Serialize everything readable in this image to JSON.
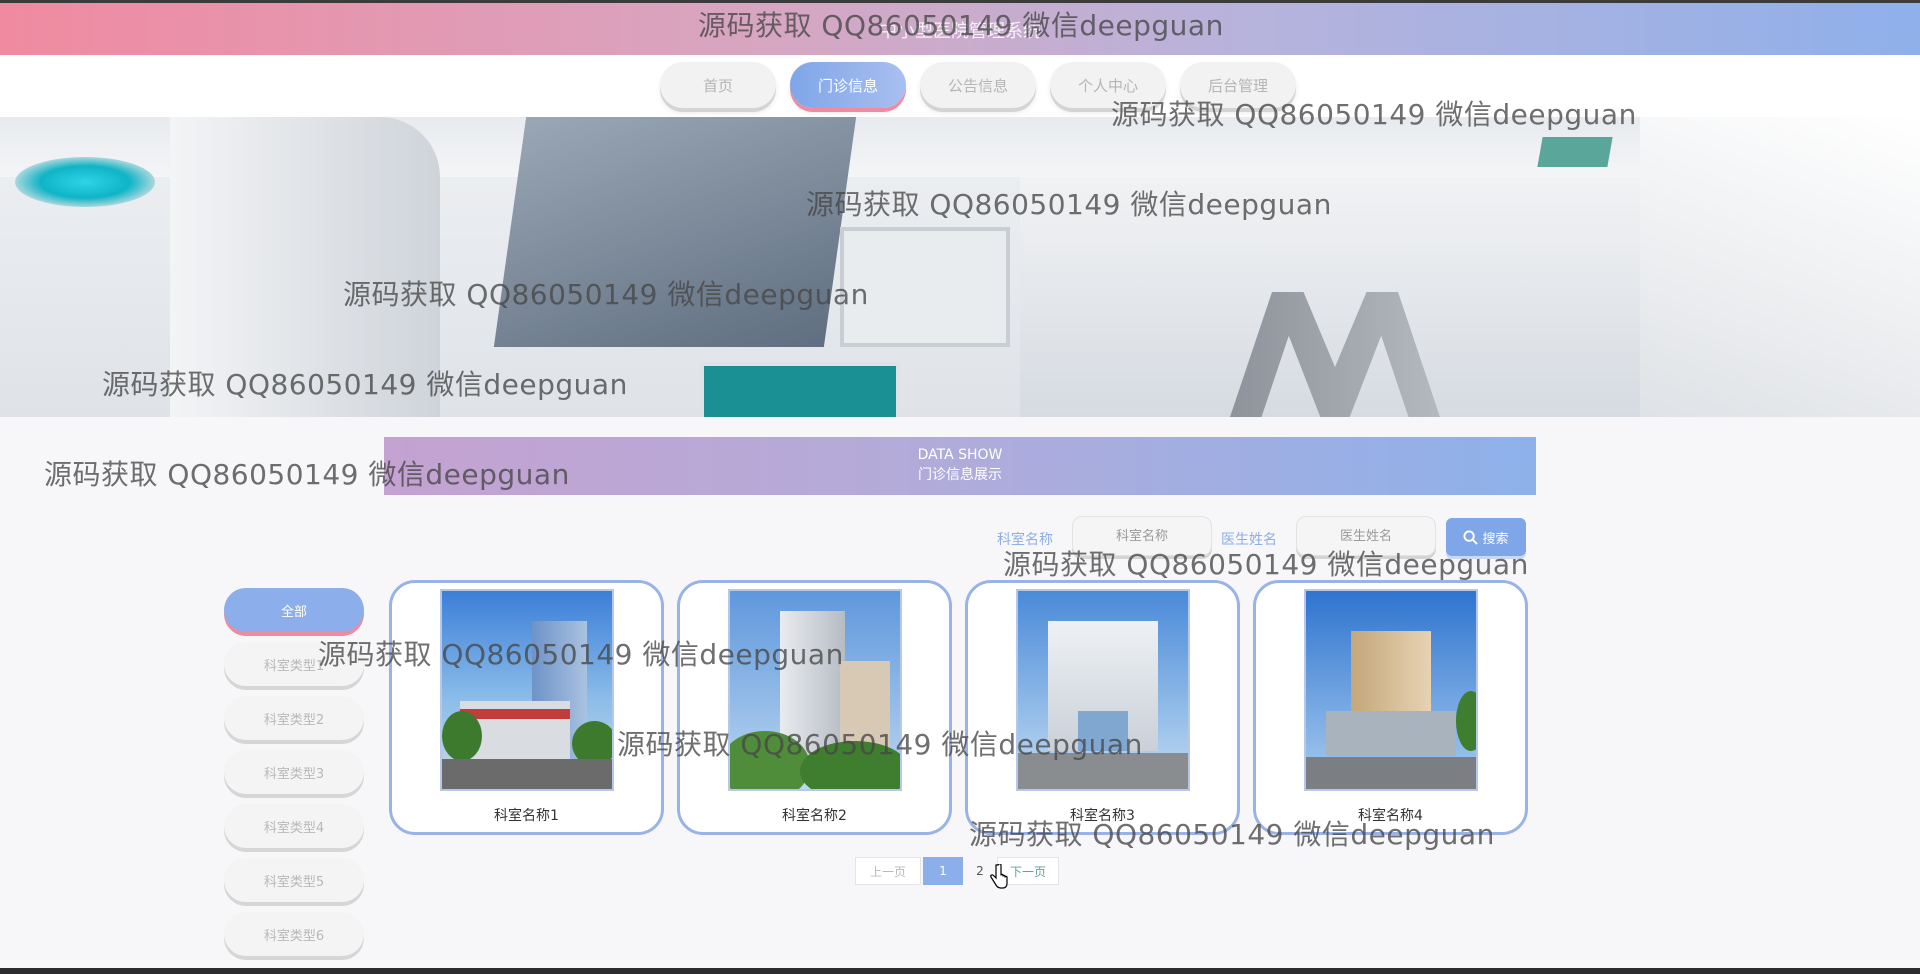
{
  "header": {
    "title": "中小型医院管理系统"
  },
  "nav": {
    "items": [
      {
        "label": "首页",
        "active": false
      },
      {
        "label": "门诊信息",
        "active": true
      },
      {
        "label": "公告信息",
        "active": false
      },
      {
        "label": "个人中心",
        "active": false
      },
      {
        "label": "后台管理",
        "active": false
      }
    ]
  },
  "section": {
    "title_en": "DATA SHOW",
    "title_cn": "门诊信息展示"
  },
  "search": {
    "dept_label": "科室名称",
    "dept_placeholder": "科室名称",
    "doctor_label": "医生姓名",
    "doctor_placeholder": "医生姓名",
    "button_label": "搜索",
    "button_icon": "search-icon"
  },
  "categories": [
    {
      "label": "全部",
      "active": true
    },
    {
      "label": "科室类型1"
    },
    {
      "label": "科室类型2"
    },
    {
      "label": "科室类型3"
    },
    {
      "label": "科室类型4"
    },
    {
      "label": "科室类型5"
    },
    {
      "label": "科室类型6"
    }
  ],
  "cards": [
    {
      "name": "科室名称1"
    },
    {
      "name": "科室名称2"
    },
    {
      "name": "科室名称3"
    },
    {
      "name": "科室名称4"
    }
  ],
  "pagination": {
    "prev": "上一页",
    "pages": [
      "1",
      "2"
    ],
    "current": "1",
    "next": "下一页"
  },
  "watermark": "源码获取 QQ86050149 微信deepguan",
  "colors": {
    "accent": "#8caeea",
    "pink": "#f08aa0",
    "border": "#9ab3e6"
  }
}
